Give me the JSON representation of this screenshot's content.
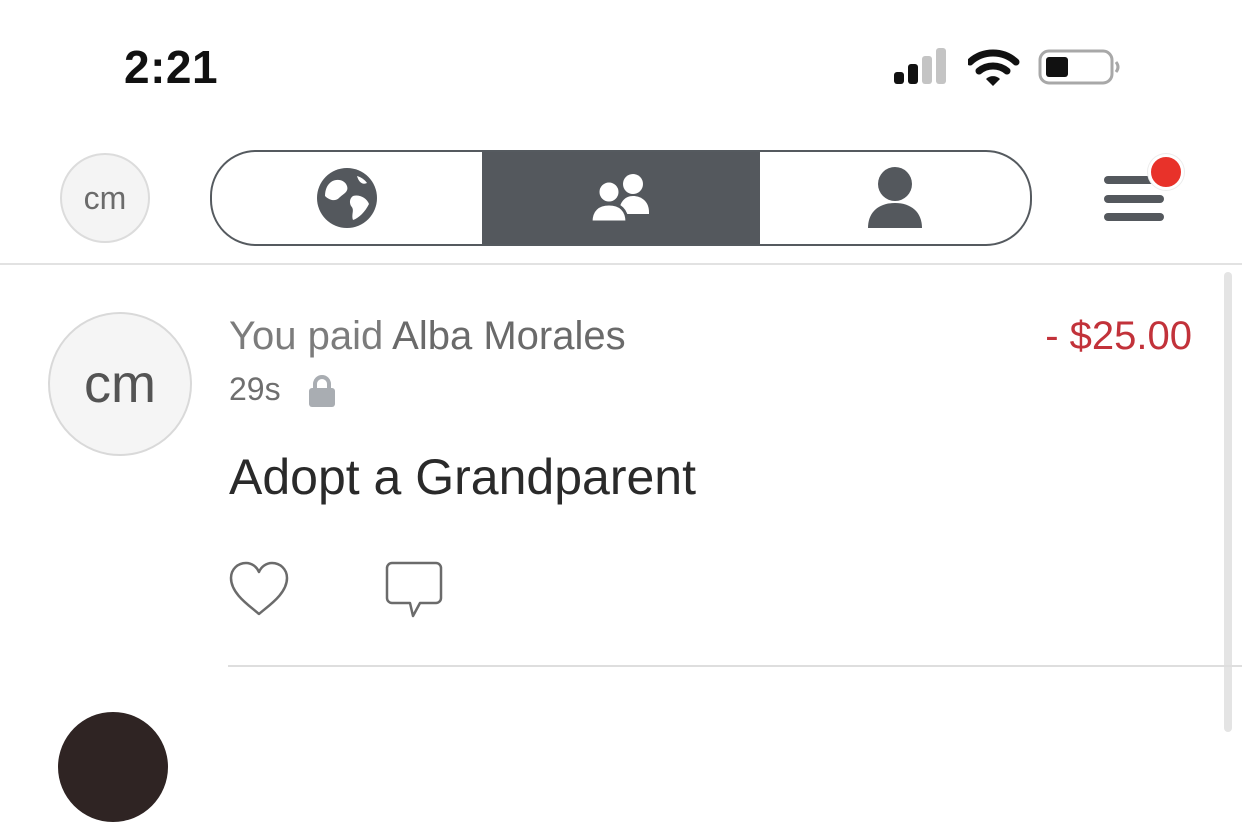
{
  "status_bar": {
    "time": "2:21",
    "icons": [
      "signal-icon",
      "wifi-icon",
      "battery-icon"
    ]
  },
  "header": {
    "avatar_initials": "cm",
    "segments": [
      {
        "name": "global",
        "icon": "globe-icon",
        "selected": false
      },
      {
        "name": "friends",
        "icon": "friends-icon",
        "selected": true
      },
      {
        "name": "personal",
        "icon": "person-icon",
        "selected": false
      }
    ],
    "menu_icon": "hamburger-menu-icon",
    "notification_dot": true
  },
  "feed": {
    "items": [
      {
        "avatar_initials": "cm",
        "action": "You paid",
        "counterparty": "Alba Morales",
        "amount": "- $25.00",
        "time": "29s",
        "privacy_icon": "lock-icon",
        "note": "Adopt a Grandparent",
        "actions": [
          "heart-icon",
          "comment-icon"
        ]
      }
    ]
  },
  "colors": {
    "accent_dark": "#54585d",
    "amount_negative": "#c2323a",
    "notification": "#e8322a"
  }
}
